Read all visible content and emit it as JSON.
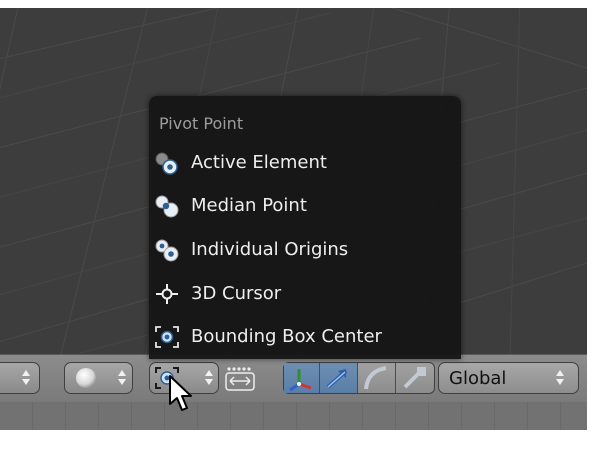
{
  "menu": {
    "title": "Pivot Point",
    "items": [
      {
        "label": "Active Element",
        "icon": "active-element-icon"
      },
      {
        "label": "Median Point",
        "icon": "median-point-icon"
      },
      {
        "label": "Individual Origins",
        "icon": "individual-origins-icon"
      },
      {
        "label": "3D Cursor",
        "icon": "3d-cursor-icon"
      },
      {
        "label": "Bounding Box Center",
        "icon": "bounding-box-center-icon"
      }
    ]
  },
  "header": {
    "transform_orientation": "Global",
    "viewport_shading_icon": "solid-sphere-icon",
    "pivot_point_icon": "bounding-box-center-icon",
    "manipulator_icons": [
      "manipulator-toggle-icon",
      "translate-arrow-icon",
      "rotate-arc-icon",
      "scale-icon"
    ]
  },
  "colors": {
    "viewport_bg": "#3d3d3d",
    "menu_bg": "#161616",
    "header_bg": "#8a8a8a",
    "accent_blue": "#5a7ea6"
  }
}
